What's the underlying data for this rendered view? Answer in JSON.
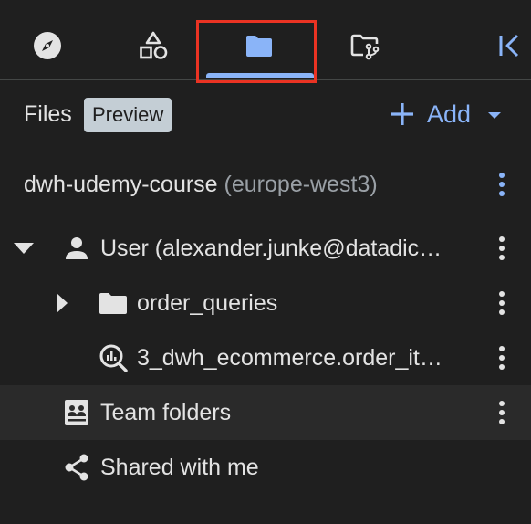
{
  "tabs": [
    {
      "name": "explorer",
      "icon": "compass-icon"
    },
    {
      "name": "assets",
      "icon": "shapes-icon"
    },
    {
      "name": "files",
      "icon": "folder-icon",
      "selected": true
    },
    {
      "name": "repositories",
      "icon": "folder-branch-icon"
    }
  ],
  "collapse_icon": "collapse-panel-icon",
  "colors": {
    "accent": "#8ab4f8",
    "highlight": "#ea3323",
    "badge_bg": "#c4ced5",
    "background": "#1f1f1f"
  },
  "header": {
    "title": "Files",
    "badge": "Preview",
    "add_label": "Add"
  },
  "project": {
    "name": "dwh-udemy-course",
    "region": "(europe-west3)"
  },
  "tree": {
    "user": {
      "label": "User (alexander.junke@datadic…",
      "expanded": true
    },
    "folder": {
      "label": "order_queries",
      "expanded": false
    },
    "query": {
      "label": "3_dwh_ecommerce.order_it…"
    },
    "team": {
      "label": "Team folders"
    },
    "shared": {
      "label": "Shared with me"
    }
  }
}
